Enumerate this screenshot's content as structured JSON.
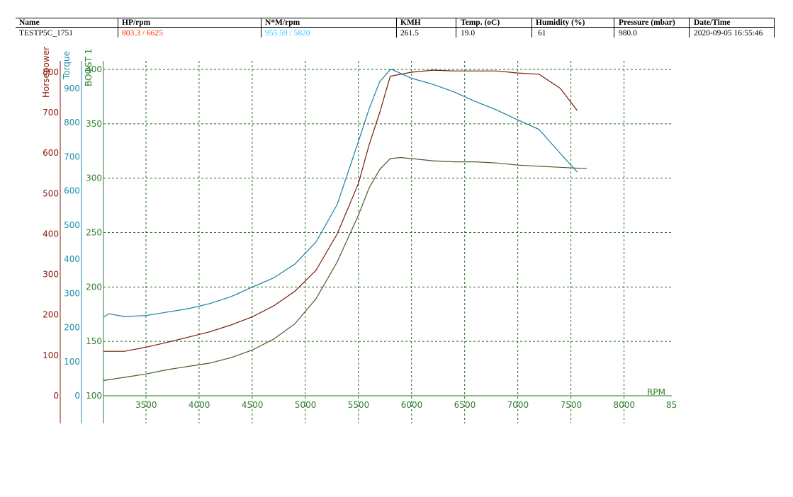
{
  "header": {
    "columns": [
      "Name",
      "HP/rpm",
      "N*M/rpm",
      "KMH",
      "Temp. (oC)",
      "Humidity (%)",
      "Pressure (mbar)",
      "Date/Time"
    ],
    "values": [
      "TESTP5C_1751",
      "803.3 / 6625",
      "955.59 / 5820",
      "261.5",
      "19.0",
      "61",
      "980.0",
      "2020-09-05 16:55:46"
    ],
    "hp_color": "#ff2a00",
    "nm_color": "#22ccff"
  },
  "chart_data": {
    "type": "line",
    "xlabel": "RPM",
    "xlim": [
      3100,
      8450
    ],
    "x_ticks": [
      "3500",
      "4000",
      "4500",
      "5000",
      "5500",
      "6000",
      "6500",
      "7000",
      "7500",
      "8000",
      "85"
    ],
    "grid": true,
    "axes": [
      {
        "label": "Horsepower",
        "color": "#8b1a0a",
        "ticks": [
          "0",
          "100",
          "200",
          "300",
          "400",
          "500",
          "600",
          "700",
          "800"
        ]
      },
      {
        "label": "Torque",
        "color": "#1a8fa8",
        "ticks": [
          "0",
          "100",
          "200",
          "300",
          "400",
          "500",
          "600",
          "700",
          "800",
          "900"
        ]
      },
      {
        "label": "BOOST 1",
        "color": "#2e7d2e",
        "ticks": [
          "100",
          "150",
          "200",
          "250",
          "300",
          "350",
          "400"
        ],
        "ylim": [
          100,
          400
        ]
      }
    ],
    "series": [
      {
        "axis": "Horsepower",
        "color": "#7a1a0a",
        "x": [
          3100,
          3300,
          3500,
          3700,
          3900,
          4100,
          4300,
          4500,
          4700,
          4900,
          5100,
          5300,
          5500,
          5600,
          5700,
          5800,
          6000,
          6200,
          6400,
          6600,
          6800,
          7000,
          7200,
          7400,
          7560
        ],
        "y": [
          110,
          110,
          120,
          132,
          145,
          158,
          175,
          195,
          222,
          258,
          310,
          400,
          525,
          620,
          700,
          790,
          800,
          805,
          803,
          803,
          803,
          798,
          795,
          760,
          705
        ]
      },
      {
        "axis": "Torque",
        "color": "#1a7fa0",
        "x": [
          3100,
          3150,
          3300,
          3500,
          3700,
          3900,
          4100,
          4300,
          4500,
          4700,
          4900,
          5100,
          5300,
          5500,
          5600,
          5700,
          5800,
          5820,
          6000,
          6200,
          6400,
          6600,
          6800,
          7000,
          7200,
          7400,
          7560
        ],
        "y": [
          230,
          240,
          232,
          235,
          245,
          255,
          270,
          290,
          318,
          345,
          385,
          450,
          560,
          745,
          840,
          920,
          955,
          955,
          930,
          912,
          890,
          862,
          837,
          808,
          780,
          710,
          655
        ]
      },
      {
        "axis": "BOOST 1",
        "color": "#4a5a28",
        "x": [
          3100,
          3300,
          3500,
          3700,
          3900,
          4100,
          4300,
          4500,
          4700,
          4900,
          5100,
          5300,
          5500,
          5600,
          5700,
          5800,
          5900,
          6000,
          6200,
          6400,
          6600,
          6800,
          7000,
          7200,
          7400,
          7600,
          7650
        ],
        "y": [
          114,
          117,
          120,
          124,
          127,
          130,
          135,
          142,
          152,
          166,
          189,
          223,
          266,
          291,
          308,
          318,
          319,
          318,
          316,
          315,
          315,
          314,
          312,
          311,
          310,
          309,
          309
        ]
      }
    ]
  }
}
